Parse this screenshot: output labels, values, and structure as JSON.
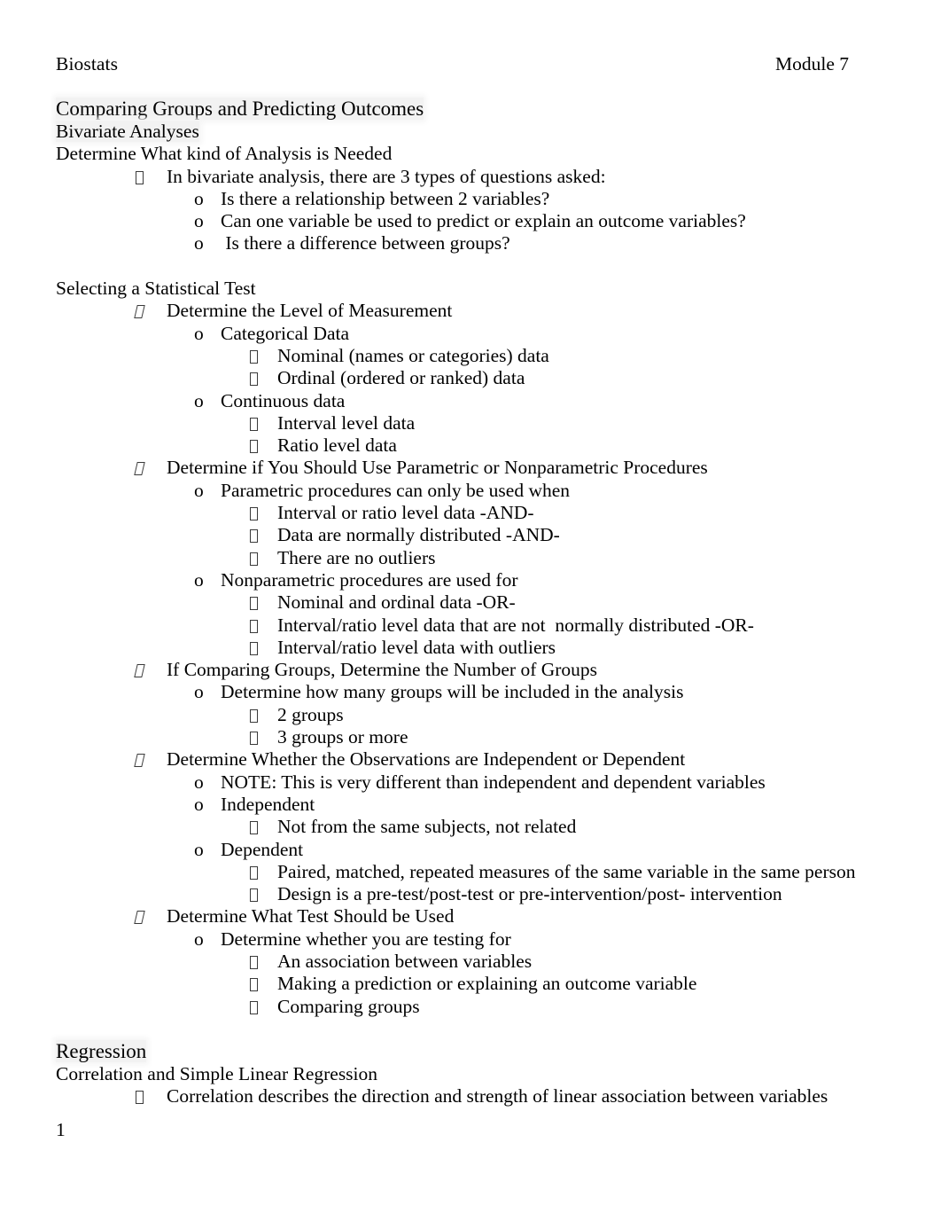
{
  "document": {
    "header": {
      "left": "Biostats",
      "right": "Module 7"
    },
    "page_number": "1",
    "highlight_color": "#f2f2f2",
    "text_color": "#000000",
    "bullet_icons": {
      "level1": "tofu-box-bullet",
      "level1_alt": "tofu-box-italic-bullet",
      "level2": "o",
      "level3": "tofu-box-bullet"
    },
    "sections": [
      {
        "title": "Comparing Groups and Predicting Outcomes",
        "title_highlighted": true,
        "subtitle": "Bivariate Analyses",
        "subtitle_highlighted": true,
        "blocks": [
          {
            "heading": "Determine What kind of Analysis is Needed",
            "items": [
              {
                "level": 1,
                "text": "In bivariate analysis, there are 3 types of questions asked:"
              },
              {
                "level": 2,
                "text": "Is there a relationship between 2 variables?"
              },
              {
                "level": 2,
                "text": "Can one variable be used to predict or explain an outcome variables?"
              },
              {
                "level": 2,
                "text": " Is there a difference between groups?"
              }
            ]
          },
          {
            "heading": "Selecting a Statistical Test",
            "items": [
              {
                "level": 1,
                "alt": true,
                "text": "Determine the Level of Measurement"
              },
              {
                "level": 2,
                "text": "Categorical Data"
              },
              {
                "level": 3,
                "text": "Nominal (names or categories) data"
              },
              {
                "level": 3,
                "text": "Ordinal (ordered or ranked) data"
              },
              {
                "level": 2,
                "text": "Continuous data"
              },
              {
                "level": 3,
                "text": "Interval level data"
              },
              {
                "level": 3,
                "text": "Ratio level data"
              },
              {
                "level": 1,
                "alt": true,
                "text": "Determine if You Should Use Parametric or Nonparametric Procedures"
              },
              {
                "level": 2,
                "text": "Parametric procedures can only be used when"
              },
              {
                "level": 3,
                "text": "Interval or ratio level data -AND-"
              },
              {
                "level": 3,
                "text": "Data are normally distributed -AND-"
              },
              {
                "level": 3,
                "text": "There are no outliers"
              },
              {
                "level": 2,
                "text": "Nonparametric procedures are used for"
              },
              {
                "level": 3,
                "text": "Nominal and ordinal data -OR-"
              },
              {
                "level": 3,
                "text": "Interval/ratio level data that are not  normally distributed -OR-"
              },
              {
                "level": 3,
                "text": "Interval/ratio level data with outliers"
              },
              {
                "level": 1,
                "alt": true,
                "text": "If Comparing Groups, Determine the Number of Groups"
              },
              {
                "level": 2,
                "text": "Determine how many groups will be included in the analysis"
              },
              {
                "level": 3,
                "text": "2 groups"
              },
              {
                "level": 3,
                "text": "3 groups or more"
              },
              {
                "level": 1,
                "alt": true,
                "text": "Determine Whether the Observations are Independent or Dependent"
              },
              {
                "level": 2,
                "text": "NOTE: This is very different than independent and dependent variables"
              },
              {
                "level": 2,
                "text": "Independent"
              },
              {
                "level": 3,
                "text": "Not from the same subjects, not related"
              },
              {
                "level": 2,
                "text": "Dependent"
              },
              {
                "level": 3,
                "text": "Paired, matched, repeated measures of the same variable in the same person"
              },
              {
                "level": 3,
                "text": "Design is a pre-test/post-test or pre-intervention/post- intervention"
              },
              {
                "level": 1,
                "alt": true,
                "text": "Determine What Test Should be Used"
              },
              {
                "level": 2,
                "text": "Determine whether you are testing for"
              },
              {
                "level": 3,
                "text": "An association between variables"
              },
              {
                "level": 3,
                "text": "Making a prediction or explaining an outcome variable"
              },
              {
                "level": 3,
                "text": "Comparing groups"
              }
            ]
          }
        ]
      },
      {
        "title": "Regression",
        "title_highlighted": true,
        "subtitle": "Correlation and Simple Linear Regression",
        "subtitle_highlighted": false,
        "blocks": [
          {
            "heading": "",
            "items": [
              {
                "level": 1,
                "text": "Correlation describes the direction and strength of linear association between variables"
              }
            ]
          }
        ]
      }
    ]
  }
}
